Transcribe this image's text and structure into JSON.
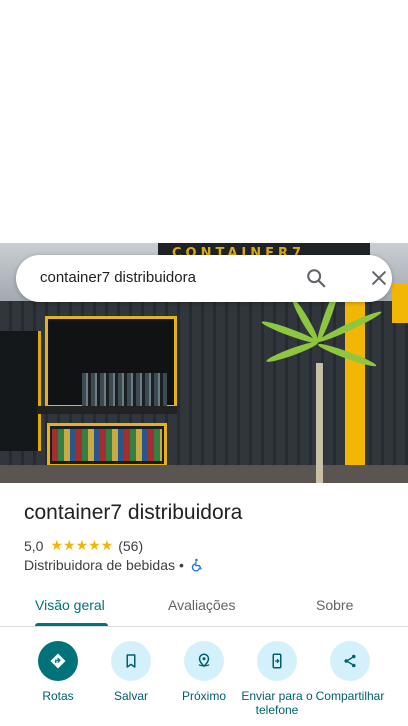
{
  "search": {
    "query": "container7 distribuidora"
  },
  "hero": {
    "sign_text": "CONTAINER7"
  },
  "place": {
    "name": "container7 distribuidora",
    "rating": "5,0",
    "stars": "★★★★★",
    "review_count": "(56)",
    "category": "Distribuidora de bebidas",
    "separator": "•"
  },
  "tabs": [
    {
      "label": "Visão geral",
      "active": true
    },
    {
      "label": "Avaliações",
      "active": false
    },
    {
      "label": "Sobre",
      "active": false
    }
  ],
  "actions": [
    {
      "label": "Rotas",
      "icon": "directions-icon"
    },
    {
      "label": "Salvar",
      "icon": "bookmark-icon"
    },
    {
      "label": "Próximo",
      "icon": "nearby-icon"
    },
    {
      "label": "Enviar para o telefone",
      "icon": "send-to-phone-icon"
    },
    {
      "label": "Compartilhar",
      "icon": "share-icon"
    }
  ],
  "colors": {
    "accent": "#00737a",
    "action_bg": "#d4f1fb",
    "star": "#f5b400",
    "accessibility": "#1a73e8"
  }
}
